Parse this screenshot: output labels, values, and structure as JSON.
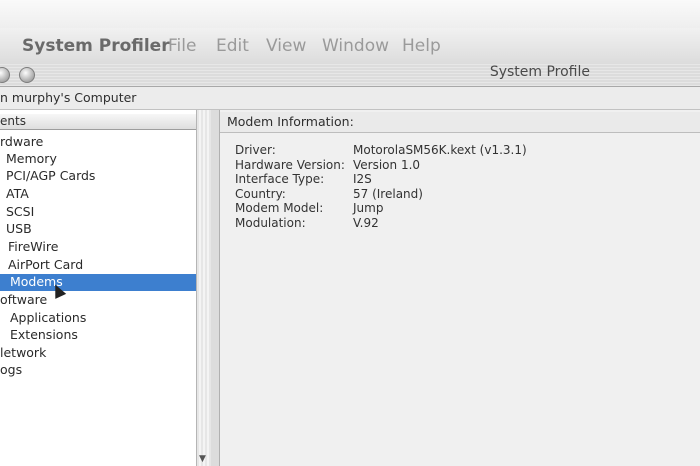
{
  "menubar": {
    "app_name": "System Profiler",
    "items": [
      "File",
      "Edit",
      "View",
      "Window",
      "Help"
    ]
  },
  "window": {
    "title": "System Profile"
  },
  "computer_name": "n murphy's Computer",
  "sidebar": {
    "header": "ents",
    "items": [
      {
        "label": "rdware",
        "selected": false
      },
      {
        "label": "Memory",
        "selected": false
      },
      {
        "label": "PCI/AGP Cards",
        "selected": false
      },
      {
        "label": "ATA",
        "selected": false
      },
      {
        "label": "SCSI",
        "selected": false
      },
      {
        "label": "USB",
        "selected": false
      },
      {
        "label": "FireWire",
        "selected": false
      },
      {
        "label": "AirPort Card",
        "selected": false
      },
      {
        "label": "Modems",
        "selected": true
      },
      {
        "label": "oftware",
        "selected": false
      },
      {
        "label": "Applications",
        "selected": false
      },
      {
        "label": "Extensions",
        "selected": false
      },
      {
        "label": "letwork",
        "selected": false
      },
      {
        "label": "ogs",
        "selected": false
      }
    ]
  },
  "detail": {
    "header": "Modem Information:",
    "rows": [
      {
        "label": "Driver:",
        "value": "MotorolaSM56K.kext (v1.3.1)"
      },
      {
        "label": "Hardware Version:",
        "value": "Version 1.0"
      },
      {
        "label": "Interface Type:",
        "value": "I2S"
      },
      {
        "label": "Country:",
        "value": "57 (Ireland)"
      },
      {
        "label": "Modem Model:",
        "value": "Jump"
      },
      {
        "label": "Modulation:",
        "value": "V.92"
      }
    ]
  },
  "colors": {
    "selection": "#3d7fcf",
    "menu_text": "#9a9a9a"
  }
}
